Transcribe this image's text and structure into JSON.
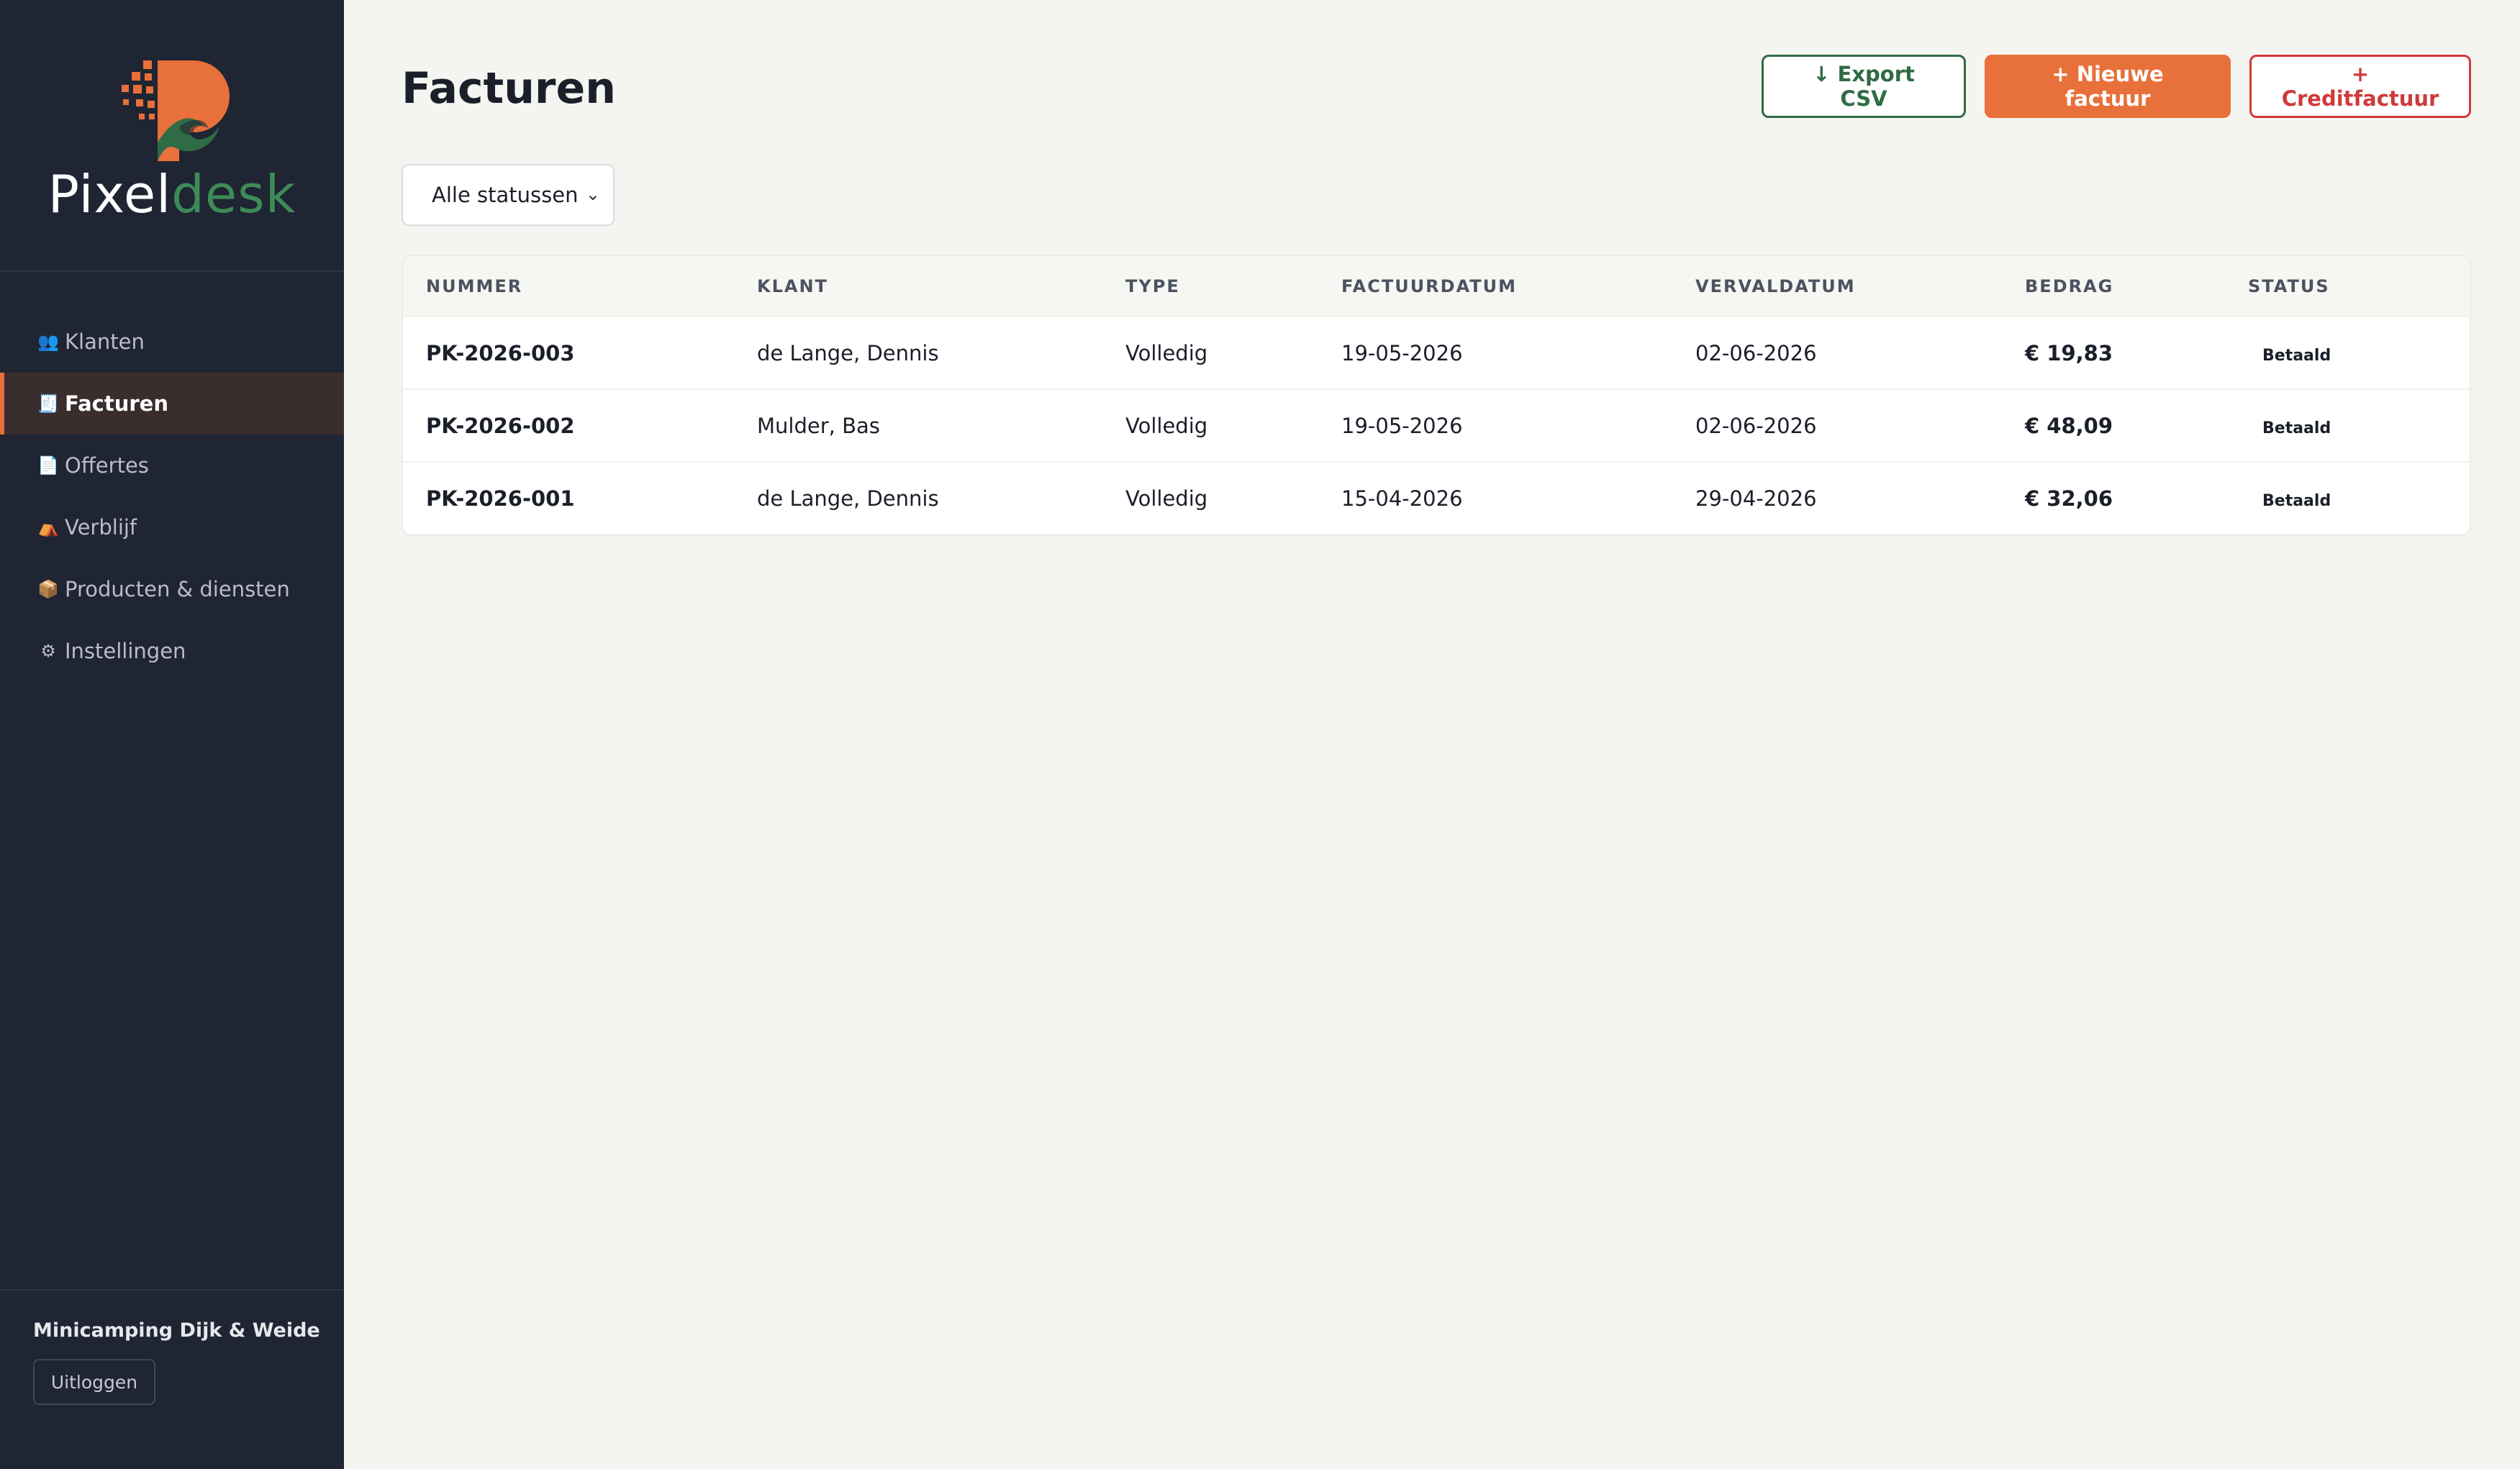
{
  "brand": {
    "part1": "Pixel",
    "part2": "desk",
    "accent": "#e8703a",
    "green": "#3d8b57"
  },
  "sidebar": {
    "items": [
      {
        "icon": "👥",
        "icon_name": "people-icon",
        "label": "Klanten"
      },
      {
        "icon": "🧾",
        "icon_name": "receipt-icon",
        "label": "Facturen",
        "active": true
      },
      {
        "icon": "📄",
        "icon_name": "document-icon",
        "label": "Offertes"
      },
      {
        "icon": "⛺",
        "icon_name": "tent-icon",
        "label": "Verblijf"
      },
      {
        "icon": "📦",
        "icon_name": "box-icon",
        "label": "Producten & diensten"
      },
      {
        "icon": "⚙",
        "icon_name": "gear-icon",
        "label": "Instellingen"
      }
    ],
    "org_name": "Minicamping Dijk & Weide",
    "logout_label": "Uitloggen"
  },
  "header": {
    "title": "Facturen",
    "export_label": "↓ Export CSV",
    "new_label": "+ Nieuwe factuur",
    "credit_label": "+ Creditfactuur"
  },
  "filter": {
    "selected": "Alle statussen",
    "chevron": "⌄"
  },
  "table": {
    "columns": [
      "NUMMER",
      "KLANT",
      "TYPE",
      "FACTUURDATUM",
      "VERVALDATUM",
      "BEDRAG",
      "STATUS"
    ],
    "rows": [
      {
        "nummer": "PK-2026-003",
        "klant": "de Lange, Dennis",
        "type": "Volledig",
        "factuurdatum": "19-05-2026",
        "vervaldatum": "02-06-2026",
        "bedrag": "€ 19,83",
        "status": "Betaald"
      },
      {
        "nummer": "PK-2026-002",
        "klant": "Mulder, Bas",
        "type": "Volledig",
        "factuurdatum": "19-05-2026",
        "vervaldatum": "02-06-2026",
        "bedrag": "€ 48,09",
        "status": "Betaald"
      },
      {
        "nummer": "PK-2026-001",
        "klant": "de Lange, Dennis",
        "type": "Volledig",
        "factuurdatum": "15-04-2026",
        "vervaldatum": "29-04-2026",
        "bedrag": "€ 32,06",
        "status": "Betaald"
      }
    ]
  }
}
